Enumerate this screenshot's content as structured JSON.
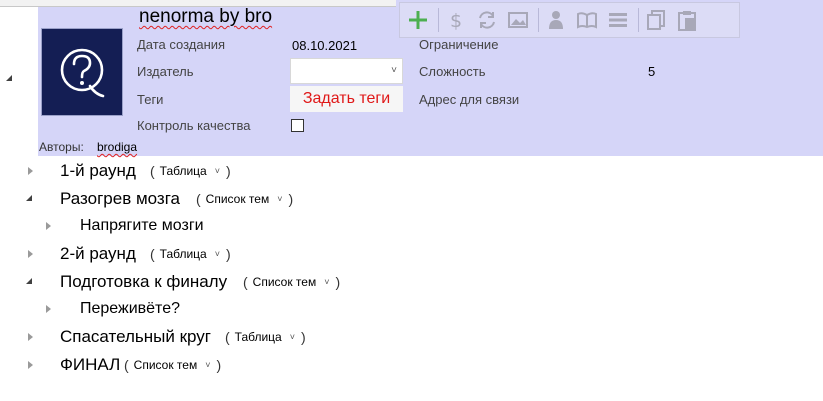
{
  "package": {
    "title": "nenorma by bro",
    "logo_glyph": "Q",
    "fields": {
      "created_label": "Дата создания",
      "created_value": "08.10.2021",
      "publisher_label": "Издатель",
      "publisher_value": "",
      "tags_label": "Теги",
      "tags_button": "Задать теги",
      "quality_label": "Контроль качества",
      "quality_checked": false,
      "restriction_label": "Ограничение",
      "restriction_value": "",
      "difficulty_label": "Сложность",
      "difficulty_value": "5",
      "contact_label": "Адрес для связи",
      "contact_value": ""
    },
    "authors_label": "Авторы:",
    "authors": [
      "brodiga"
    ]
  },
  "toolbar": {
    "icons": [
      "add-icon",
      "dollar-icon",
      "refresh-icon",
      "image-icon",
      "person-icon",
      "book-icon",
      "list-icon",
      "copy-icon",
      "paste-icon"
    ]
  },
  "colors": {
    "header_bg": "#d5d5f8",
    "toolbar_bg": "#dcdcf6",
    "tags_text": "#e01818",
    "add_icon": "#4caf50",
    "logo_bg": "#141e54"
  },
  "rounds": [
    {
      "name": "1-й раунд",
      "type": "Таблица",
      "expanded": false,
      "themes": []
    },
    {
      "name": "Разогрев мозга",
      "type": "Список тем",
      "expanded": true,
      "themes": [
        "Напрягите мозги"
      ]
    },
    {
      "name": "2-й раунд",
      "type": "Таблица",
      "expanded": false,
      "themes": []
    },
    {
      "name": "Подготовка к финалу",
      "type": "Список тем",
      "expanded": true,
      "themes": [
        "Переживёте?"
      ]
    },
    {
      "name": "Спасательный круг",
      "type": "Таблица",
      "expanded": false,
      "themes": []
    },
    {
      "name": "ФИНАЛ",
      "type": "Список тем",
      "expanded": false,
      "themes": []
    }
  ]
}
